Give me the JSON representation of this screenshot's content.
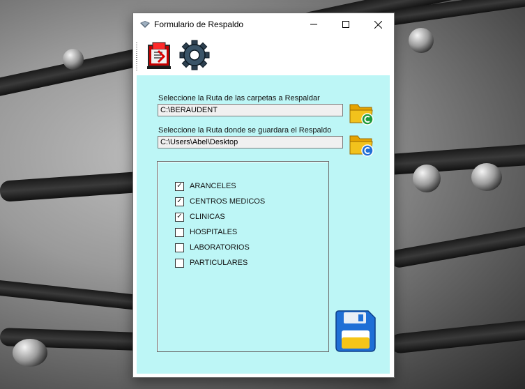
{
  "window": {
    "title": "Formulario de Respaldo",
    "controls": {
      "minimize": "—",
      "maximize": "☐",
      "close": "✕"
    }
  },
  "toolbar": {
    "tools": [
      {
        "icon": "export-icon"
      },
      {
        "icon": "gear-icon"
      }
    ]
  },
  "form": {
    "source_label": "Seleccione la Ruta de las carpetas a Respaldar",
    "source_value": "C:\\BERAUDENT",
    "dest_label": "Seleccione la Ruta donde se guardara el Respaldo",
    "dest_value": "C:\\Users\\Abel\\Desktop"
  },
  "checklist": [
    {
      "label": "ARANCELES",
      "checked": true
    },
    {
      "label": "CENTROS MEDICOS",
      "checked": true
    },
    {
      "label": "CLINICAS",
      "checked": true
    },
    {
      "label": "HOSPITALES",
      "checked": false
    },
    {
      "label": "LABORATORIOS",
      "checked": false
    },
    {
      "label": "PARTICULARES",
      "checked": false
    }
  ],
  "colors": {
    "panel": "#bdf6f6",
    "accent_blue": "#1f6fd6",
    "folder_yellow": "#f2c21c"
  }
}
